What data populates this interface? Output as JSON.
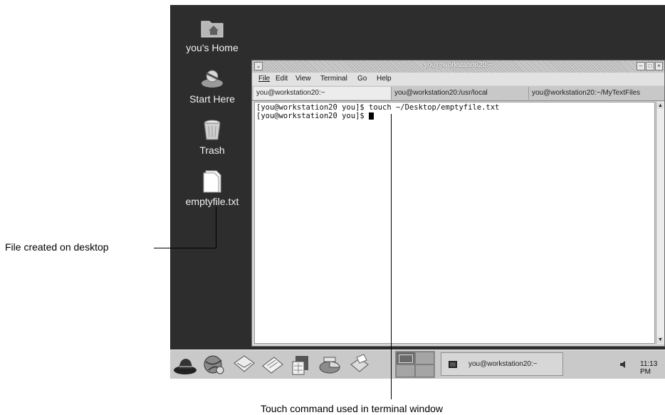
{
  "desktop": {
    "icons": [
      {
        "label": "you's Home",
        "icon": "home-folder-icon"
      },
      {
        "label": "Start Here",
        "icon": "start-here-icon"
      },
      {
        "label": "Trash",
        "icon": "trash-icon"
      },
      {
        "label": "emptyfile.txt",
        "icon": "text-file-icon"
      }
    ]
  },
  "terminal": {
    "title": "you@workstation20:~",
    "menu": [
      "File",
      "Edit",
      "View",
      "Terminal",
      "Go",
      "Help"
    ],
    "tabs": [
      "you@workstation20:~",
      "you@workstation20:/usr/local",
      "you@workstation20:~/MyTextFiles"
    ],
    "active_tab": 0,
    "lines": [
      "[you@workstation20 you]$ touch ~/Desktop/emptyfile.txt",
      "[you@workstation20 you]$ "
    ]
  },
  "panel": {
    "task_label": "you@workstation20:~",
    "clock": "11:13 PM"
  },
  "annotations": {
    "left": "File created on desktop",
    "bottom": "Touch command used in terminal window"
  },
  "colors": {
    "desktop": "#2d2d2d",
    "panel": "#c9c9c9",
    "terminal_bg": "#ffffff"
  }
}
